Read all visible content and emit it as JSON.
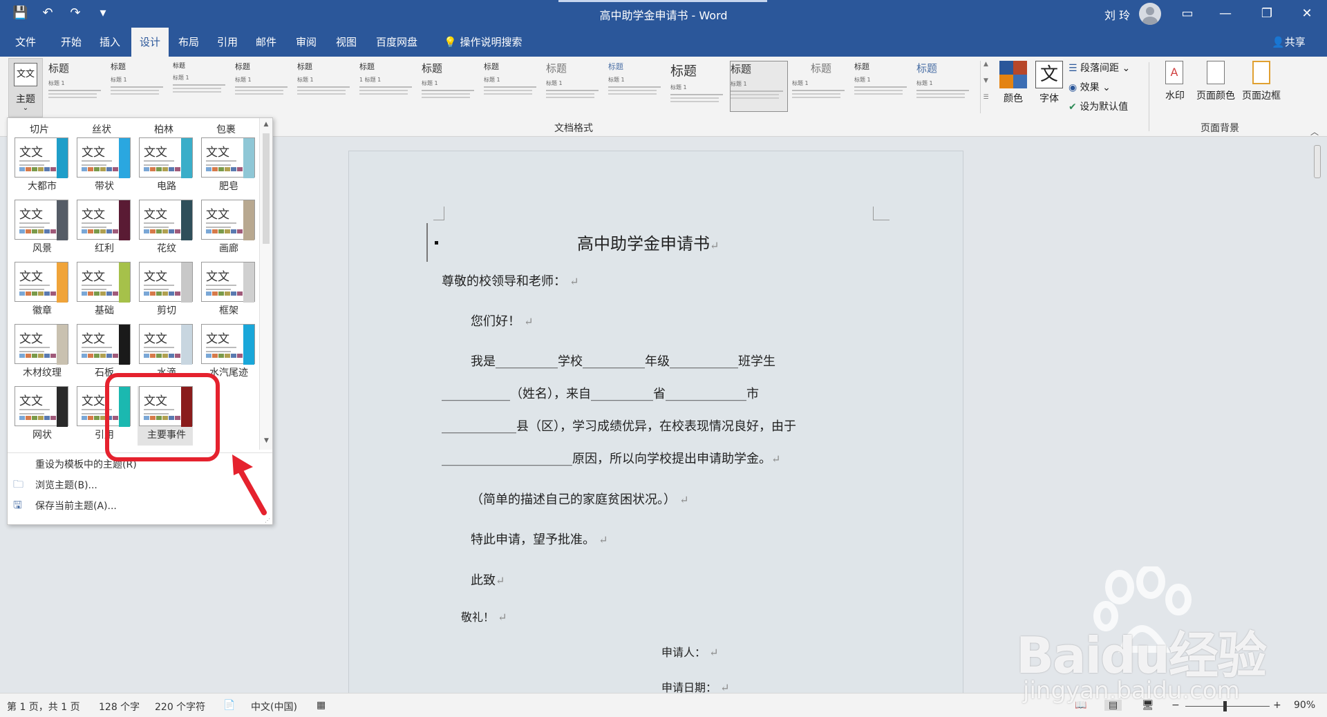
{
  "window": {
    "title": "高中助学金申请书 - Word",
    "user": "刘 玲"
  },
  "qat": {
    "save": "💾",
    "undo": "↶",
    "redo": "↷",
    "customize": "▾"
  },
  "menu": {
    "tabs": [
      "文件",
      "开始",
      "插入",
      "设计",
      "布局",
      "引用",
      "邮件",
      "审阅",
      "视图",
      "百度网盘"
    ],
    "active": "设计",
    "tell_me": "操作说明搜索",
    "share": "共享"
  },
  "ribbon": {
    "theme_label": "主题",
    "theme_icon_text": "文文",
    "styles_group_label": "文档格式",
    "style_items": [
      {
        "h": "标题",
        "s": "标题 1"
      },
      {
        "h": "标题",
        "s": "标题 1"
      },
      {
        "h": "标题",
        "s": "标题 1"
      },
      {
        "h": "标题",
        "s": "标题 1"
      },
      {
        "h": "标题",
        "s": "标题 1"
      },
      {
        "h": "标题",
        "s": "1 标题 1"
      },
      {
        "h": "标题",
        "s": "标题 1"
      },
      {
        "h": "标题",
        "s": "标题 1"
      },
      {
        "h": "标题",
        "s": "标题 1"
      },
      {
        "h": "标题",
        "s": "标题 1"
      },
      {
        "h": "标题",
        "s": "标题 1"
      },
      {
        "h": "标题",
        "s": "标题 1"
      },
      {
        "h": "标题",
        "s": "标题 1"
      },
      {
        "h": "标题",
        "s": "标题 1"
      },
      {
        "h": "标题",
        "s": "标题 1"
      }
    ],
    "colors_label": "颜色",
    "fonts_label": "字体",
    "fonts_icon": "文",
    "para_spacing_label": "段落间距",
    "effects_label": "效果",
    "set_default_label": "设为默认值",
    "watermark_label": "水印",
    "page_color_label": "页面颜色",
    "page_border_label": "页面边框",
    "page_bg_group_label": "页面背景"
  },
  "dropdown": {
    "partial_row": [
      "切片",
      "丝状",
      "柏林",
      "包裹"
    ],
    "themes": [
      {
        "name": "大都市",
        "bar": "#1f9ec9"
      },
      {
        "name": "带状",
        "bar": "#2aa7e0"
      },
      {
        "name": "电路",
        "bar": "#3aaec9"
      },
      {
        "name": "肥皂",
        "bar": "#8fc7d6"
      },
      {
        "name": "风景",
        "bar": "#555c66"
      },
      {
        "name": "红利",
        "bar": "#5a1b34"
      },
      {
        "name": "花纹",
        "bar": "#2f4f5a"
      },
      {
        "name": "画廊",
        "bar": "#b8a890"
      },
      {
        "name": "徽章",
        "bar": "#f0a43a"
      },
      {
        "name": "基础",
        "bar": "#a6c14a"
      },
      {
        "name": "剪切",
        "bar": "#c8c8c8"
      },
      {
        "name": "框架",
        "bar": "#d0d0d0"
      },
      {
        "name": "木材纹理",
        "bar": "#c9c1b0"
      },
      {
        "name": "石板",
        "bar": "#1a1a1a"
      },
      {
        "name": "水滴",
        "bar": "#c8d6e0"
      },
      {
        "name": "水汽尾迹",
        "bar": "#1aa7d9"
      },
      {
        "name": "网状",
        "bar": "#2a2a2a"
      },
      {
        "name": "引用",
        "bar": "#1bb8b0"
      },
      {
        "name": "主要事件",
        "bar": "#8a1c1c"
      }
    ],
    "thumb_text": "文文",
    "selected": "主要事件",
    "reset": "重设为模板中的主题(R)",
    "browse": "浏览主题(B)...",
    "save": "保存当前主题(A)..."
  },
  "document": {
    "title": "高中助学金申请书",
    "salutation": "尊敬的校领导和老师：",
    "greeting": "您们好！",
    "line1": "我是__________学校__________年级___________班学生",
    "line2": "___________（姓名），来自__________省_____________市",
    "line3": "____________县（区），学习成绩优异，在校表现情况良好，由于",
    "line4": "_____________________原因，所以向学校提出申请助学金。",
    "line5": "（简单的描述自己的家庭贫困状况。）",
    "line6": "特此申请，望予批准。",
    "closing1": "此致",
    "closing2": "敬礼！",
    "applicant": "申请人：",
    "date": "申请日期："
  },
  "status": {
    "page": "第 1 页，共 1 页",
    "words": "128 个字",
    "chars": "220 个字符",
    "lang": "中文(中国)",
    "zoom": "90%"
  },
  "watermark": {
    "brand": "Baidu经验",
    "url": "jingyan.baidu.com"
  },
  "colors": {
    "word_blue": "#2b579a",
    "highlight_red": "#e5222e"
  }
}
